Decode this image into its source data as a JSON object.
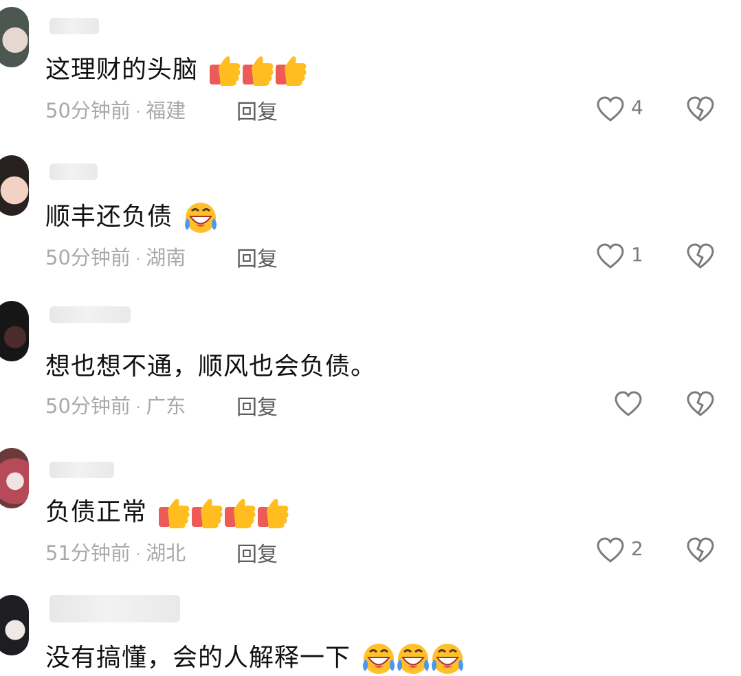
{
  "comments": [
    {
      "text": "这理财的头脑",
      "emoji": "thumbs-up-icon",
      "emoji_count": 3,
      "time": "50分钟前",
      "region": "福建",
      "reply_label": "回复",
      "likes": "4"
    },
    {
      "text": "顺丰还负债",
      "emoji": "laughing-crying-icon",
      "emoji_count": 1,
      "time": "50分钟前",
      "region": "湖南",
      "reply_label": "回复",
      "likes": "1"
    },
    {
      "text": "想也想不通，顺风也会负债。",
      "emoji": "",
      "emoji_count": 0,
      "time": "50分钟前",
      "region": "广东",
      "reply_label": "回复",
      "likes": ""
    },
    {
      "text": "负债正常",
      "emoji": "thumbs-up-icon",
      "emoji_count": 4,
      "time": "51分钟前",
      "region": "湖北",
      "reply_label": "回复",
      "likes": "2"
    },
    {
      "text": "没有搞懂，会的人解释一下",
      "emoji": "laughing-crying-icon",
      "emoji_count": 3,
      "time": "",
      "region": "",
      "reply_label": "",
      "likes": ""
    }
  ],
  "meta_separator": "·"
}
